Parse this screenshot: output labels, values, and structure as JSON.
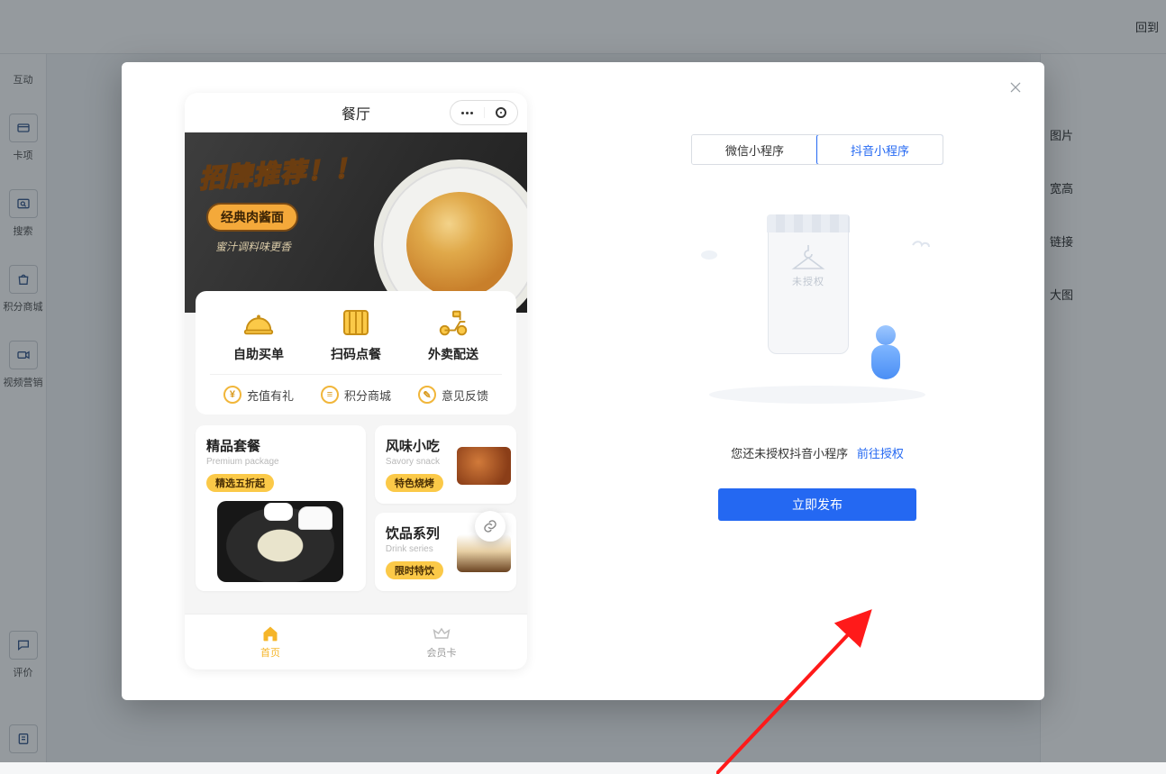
{
  "header": {
    "back_link": "回到"
  },
  "sidebar": {
    "items": [
      {
        "label": "互动"
      },
      {
        "label": "卡项"
      },
      {
        "label": "搜索"
      },
      {
        "label": "积分商城"
      },
      {
        "label": "视频营销"
      },
      {
        "label": "评价"
      }
    ]
  },
  "right_panel": {
    "labels": [
      "图片",
      "宽高",
      "链接",
      "大图"
    ]
  },
  "modal": {
    "tabs": {
      "wechat": "微信小程序",
      "douyin": "抖音小程序"
    },
    "empty_tag": "未授权",
    "message": "您还未授权抖音小程序",
    "auth_link": "前往授权",
    "publish": "立即发布"
  },
  "preview": {
    "title": "餐厅",
    "banner": {
      "headline": "招牌推荐！！",
      "badge": "经典肉酱面",
      "sub": "蜜汁调料味更香"
    },
    "quick3": [
      "自助买单",
      "扫码点餐",
      "外卖配送"
    ],
    "quick3b": [
      "充值有礼",
      "积分商城",
      "意见反馈"
    ],
    "premium": {
      "title": "精品套餐",
      "en": "Premium package",
      "chip": "精选五折起"
    },
    "savory": {
      "title": "风味小吃",
      "en": "Savory snack",
      "chip": "特色烧烤"
    },
    "drink": {
      "title": "饮品系列",
      "en": "Drink series",
      "chip": "限时特饮"
    },
    "tabs": {
      "home": "首页",
      "member": "会员卡"
    }
  }
}
